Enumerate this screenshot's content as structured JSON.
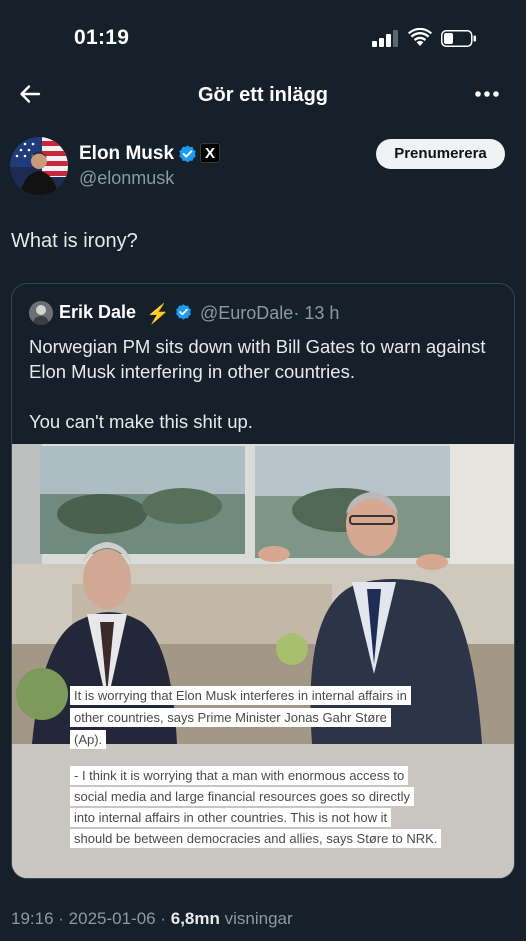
{
  "status_bar": {
    "time": "01:19"
  },
  "nav": {
    "title": "Gör ett inlägg"
  },
  "author": {
    "name": "Elon Musk",
    "handle": "@elonmusk",
    "affiliate_badge": "X",
    "subscribe_label": "Prenumerera"
  },
  "tweet": {
    "text": "What is irony?"
  },
  "quote": {
    "author_name": "Erik Dale",
    "emoji": "⚡",
    "handle": "@EuroDale",
    "time": "· 13 h",
    "paragraphs": [
      "Norwegian PM sits down with Bill Gates to warn against Elon Musk interfering in other countries.",
      "You can't make this shit up."
    ],
    "image_caption": [
      "It is worrying that Elon Musk interferes in internal affairs in",
      "other countries, says Prime Minister Jonas Gahr Støre",
      "(Ap).",
      "- I think it is worrying that a man with enormous access to",
      "social media and large financial resources goes so directly",
      "into internal affairs in other countries. This is not how it",
      "should be between democracies and allies, says Støre to NRK."
    ]
  },
  "footer": {
    "time": "19:16",
    "date": "2025-01-06",
    "views_count": "6,8mn",
    "views_label": "visningar"
  },
  "colors": {
    "background": "#15202b",
    "verified": "#1d9bf0",
    "secondary_text": "#8b98a5"
  }
}
